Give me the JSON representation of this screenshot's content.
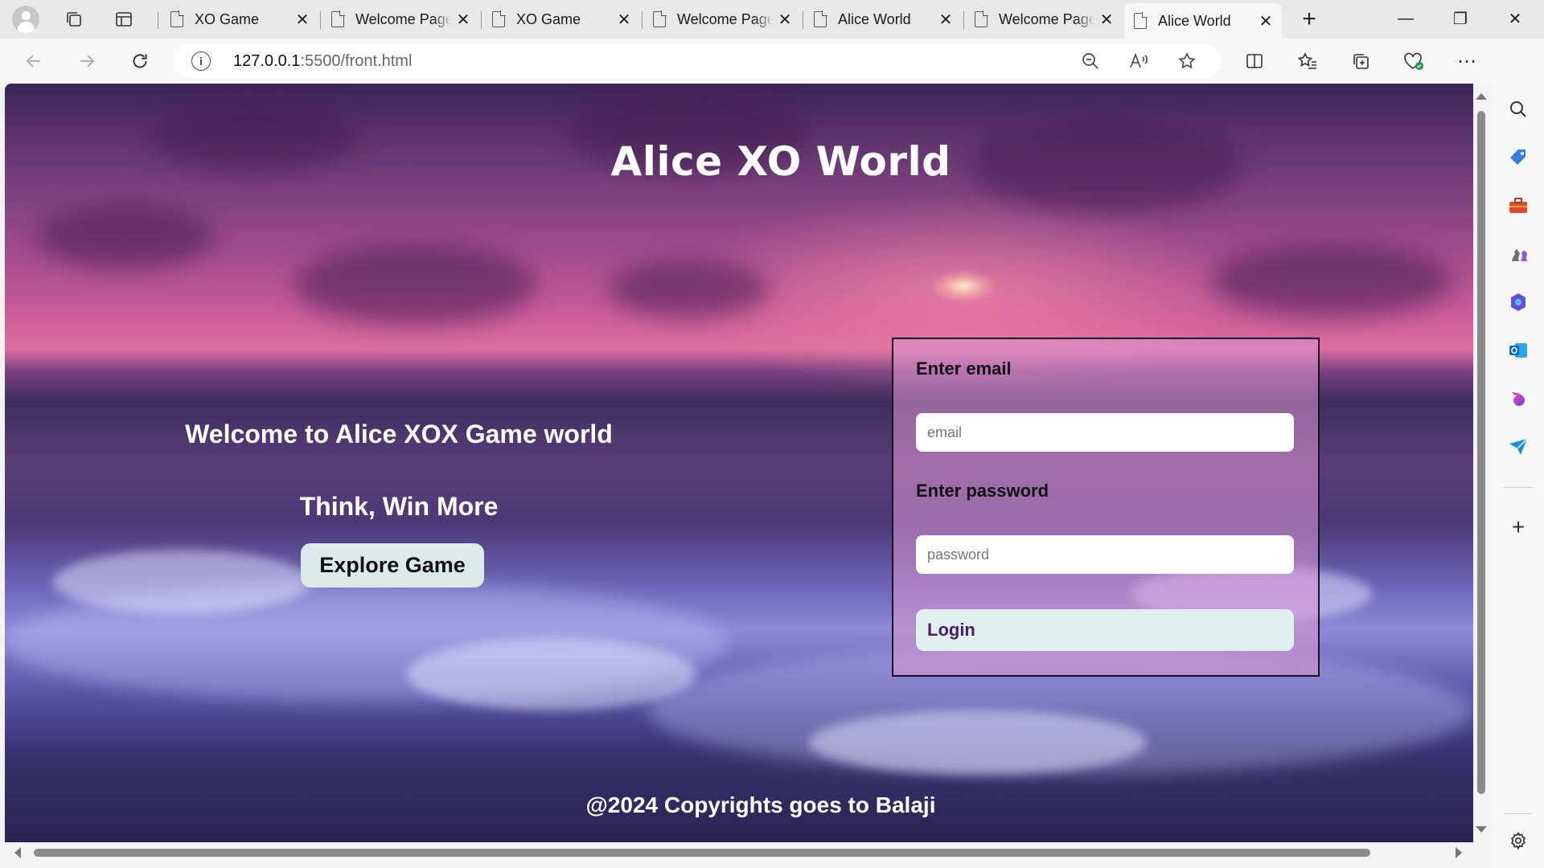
{
  "browser": {
    "tabs": [
      {
        "title": "XO Game",
        "active": false
      },
      {
        "title": "Welcome Page",
        "active": false
      },
      {
        "title": "XO Game",
        "active": false
      },
      {
        "title": "Welcome Page",
        "active": false
      },
      {
        "title": "Alice World",
        "active": false
      },
      {
        "title": "Welcome Page",
        "active": false
      },
      {
        "title": "Alice World",
        "active": true
      }
    ],
    "new_tab_glyph": "+",
    "close_glyph": "✕",
    "window_controls": {
      "minimize": "—",
      "restore": "❐",
      "close": "✕"
    },
    "address": {
      "host": "127.0.0.1",
      "rest": ":5500/front.html"
    },
    "sidebar_icons": [
      "search-icon",
      "tag-icon",
      "briefcase-icon",
      "chess-icon",
      "copilot-app-icon",
      "outlook-icon",
      "drop-icon",
      "send-icon",
      "add-icon",
      "settings-icon"
    ]
  },
  "page": {
    "title": "Alice XO World",
    "welcome": "Welcome to Alice XOX Game world",
    "tagline": "Think, Win More",
    "explore_button": "Explore Game",
    "login": {
      "email_label": "Enter email",
      "email_placeholder": "email",
      "password_label": "Enter password",
      "password_placeholder": "password",
      "button": "Login"
    },
    "footer": "@2024 Copyrights goes to Balaji"
  }
}
